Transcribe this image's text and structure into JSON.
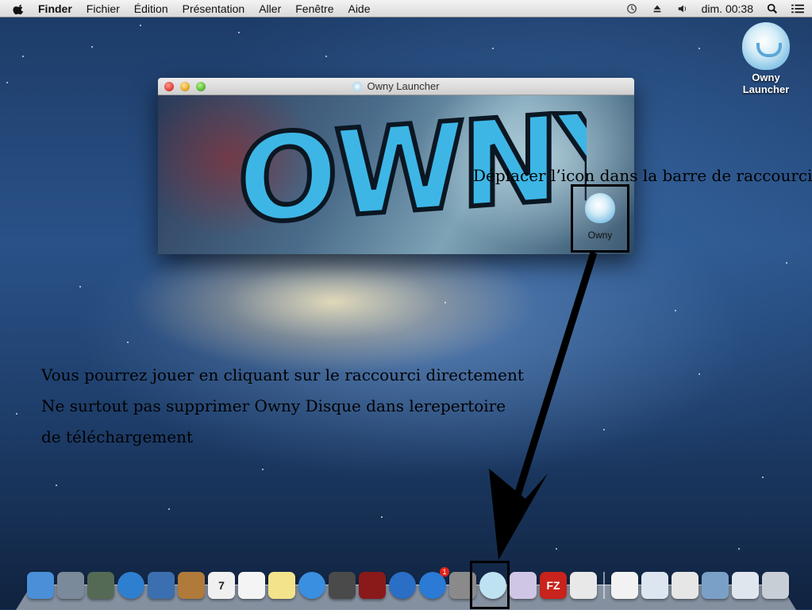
{
  "menubar": {
    "app": "Finder",
    "items": [
      "Fichier",
      "Édition",
      "Présentation",
      "Aller",
      "Fenêtre",
      "Aide"
    ],
    "clock": "dim. 00:38"
  },
  "desktop_icon": {
    "label_line1": "Owny",
    "label_line2": "Launcher"
  },
  "window": {
    "title": "Owny Launcher",
    "logo_text": "OWNY",
    "tile_label": "Owny"
  },
  "annotations": {
    "move_hint": "Déplacer l’icon dans la barre de raccourcis",
    "line1": "Vous pourrez jouer en cliquant sur le raccourci directement",
    "line2": "Ne surtout pas supprimer Owny Disque dans lerepertoire",
    "line3": "de téléchargement"
  },
  "dock": {
    "apps": [
      {
        "name": "finder-icon",
        "color": "#4a8fd8"
      },
      {
        "name": "launchpad-icon",
        "color": "#7b8a9a"
      },
      {
        "name": "mission-control-icon",
        "color": "#556a55"
      },
      {
        "name": "safari-icon",
        "color": "#2f7fd0"
      },
      {
        "name": "mail-icon",
        "color": "#3b6fb0"
      },
      {
        "name": "contacts-icon",
        "color": "#b07a3a"
      },
      {
        "name": "calendar-icon",
        "color": "#f0f0f0",
        "text": "7"
      },
      {
        "name": "reminders-icon",
        "color": "#f4f4f4"
      },
      {
        "name": "notes-icon",
        "color": "#f3e38a"
      },
      {
        "name": "messages-icon",
        "color": "#3a8fe0"
      },
      {
        "name": "facetime-icon",
        "color": "#4a4a4a"
      },
      {
        "name": "photo-booth-icon",
        "color": "#8a1a1a"
      },
      {
        "name": "itunes-icon",
        "color": "#2a6ec6"
      },
      {
        "name": "app-store-icon",
        "color": "#2a7ad6",
        "badge": "1"
      },
      {
        "name": "system-preferences-icon",
        "color": "#8a8a8a"
      },
      {
        "name": "owny-icon",
        "color": "#bfe2f2"
      },
      {
        "name": "wizard-icon",
        "color": "#cfc6e6"
      },
      {
        "name": "filezilla-icon",
        "color": "#c8231c",
        "text": "FZ"
      },
      {
        "name": "textedit-icon",
        "color": "#e8e8e8"
      }
    ],
    "docs": [
      {
        "name": "dmg-document-icon",
        "color": "#f2f2f2"
      },
      {
        "name": "window-thumbnail-icon",
        "color": "#dde6f0"
      },
      {
        "name": "filezilla-window-icon",
        "color": "#e6e6e6"
      },
      {
        "name": "desktop-thumbnail-icon",
        "color": "#7aa0c8"
      },
      {
        "name": "finder-window-icon",
        "color": "#e0e6ee"
      },
      {
        "name": "trash-icon",
        "color": "#c8ced6"
      }
    ]
  }
}
